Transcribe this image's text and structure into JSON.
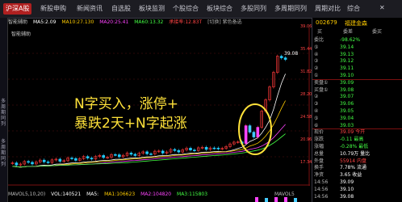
{
  "topbar": {
    "tabs": [
      "沪深A股",
      "新股申购",
      "新闻资讯",
      "自选股",
      "板块监测",
      "个股综合",
      "板块综合",
      "多股同列",
      "多周期同列",
      "周期对比",
      "综合"
    ],
    "active_index": 0
  },
  "info_line": {
    "items": [
      {
        "text": "智能辅助",
        "color": "#c8c8c8"
      },
      {
        "text": "MA5:2.09",
        "color": "#ffffff"
      },
      {
        "text": "MA10:27.130",
        "color": "#ffcc00"
      },
      {
        "text": "MA20:25.41",
        "color": "#ff44ff"
      },
      {
        "text": "MA60:13.32",
        "color": "#44ff44"
      },
      {
        "text": "承接率:12.83T",
        "color": "#ff4444"
      },
      {
        "text": "[切换] 紫色备选",
        "color": "#aaaaaa"
      }
    ]
  },
  "chart_top_label": "智能辅助",
  "chart_price_label": "39.08",
  "annotation": {
    "line1": "N字买入，涨停+",
    "line2": "暴跌2天+N字起涨"
  },
  "sub_bar": {
    "items": [
      {
        "text": "MAVOL5,10,20)",
        "color": "#bbbbbb"
      },
      {
        "text": "VOL:140521",
        "color": "#ffffff"
      },
      {
        "text": "MA5:",
        "color": "#ffffff"
      },
      {
        "text": "MA1:106623",
        "color": "#ffcc00"
      },
      {
        "text": "MA2:104820",
        "color": "#ff44ff"
      },
      {
        "text": "MA3:115803",
        "color": "#44ff44"
      },
      {
        "text": "MAVOL5",
        "color": "#bbbbbb"
      }
    ]
  },
  "left_sidebar": {
    "labels": [
      "多周期同列",
      "多周期同列"
    ]
  },
  "quote_panel": {
    "code": "002679",
    "name": "福建金森",
    "tabs": [
      "买",
      "委差",
      "委买"
    ],
    "rows": [
      {
        "lab": "委比",
        "val": "-98.62%",
        "c": "#44ff44"
      },
      {
        "lab": "⑤",
        "val": "39.14",
        "c": "#44ff44"
      },
      {
        "lab": "④",
        "val": "39.13",
        "c": "#44ff44"
      },
      {
        "lab": "③",
        "val": "39.12",
        "c": "#44ff44"
      },
      {
        "lab": "②",
        "val": "39.11",
        "c": "#44ff44"
      },
      {
        "lab": "①",
        "val": "39.10",
        "c": "#44ff44"
      },
      {
        "lab": "卖盘①",
        "val": "39.09",
        "c": "#44ff44"
      },
      {
        "lab": "买盘①",
        "val": "39.08",
        "c": "#44ff44"
      },
      {
        "lab": "②",
        "val": "39.07",
        "c": "#44ff44"
      },
      {
        "lab": "③",
        "val": "39.06",
        "c": "#44ff44"
      },
      {
        "lab": "④",
        "val": "39.05",
        "c": "#44ff44"
      },
      {
        "lab": "⑤",
        "val": "39.04",
        "c": "#44ff44"
      },
      {
        "lab": "⑥",
        "val": "39.03",
        "c": "#44ff44"
      },
      {
        "lab": "现价",
        "val": "39.09 今开",
        "c": "#ff4444"
      },
      {
        "lab": "涨跌",
        "val": "-0.11 最高",
        "c": "#44ff44"
      },
      {
        "lab": "涨幅",
        "val": "-0.28% 最低",
        "c": "#44ff44"
      },
      {
        "lab": "总量",
        "val": "10.79万 量比",
        "c": "#ffffff"
      },
      {
        "lab": "外盘",
        "val": "55914 内盘",
        "c": "#ff4444"
      },
      {
        "lab": "换手",
        "val": "7.78% 流通",
        "c": "#ffffff"
      },
      {
        "lab": "净资",
        "val": "3.65 收益",
        "c": "#ffffff"
      },
      {
        "lab": "14:56",
        "val": "39.09",
        "c": "#ffffff"
      },
      {
        "lab": "14:56",
        "val": "39.10",
        "c": "#ffffff"
      },
      {
        "lab": "14:56",
        "val": "39.08",
        "c": "#ffffff"
      }
    ]
  },
  "axis": {
    "ticks": [
      "39.06",
      "35.44",
      "31.82",
      "28.20",
      "24.58",
      "20.96",
      "17.34"
    ]
  },
  "indicator_label": "MAVOL5"
}
